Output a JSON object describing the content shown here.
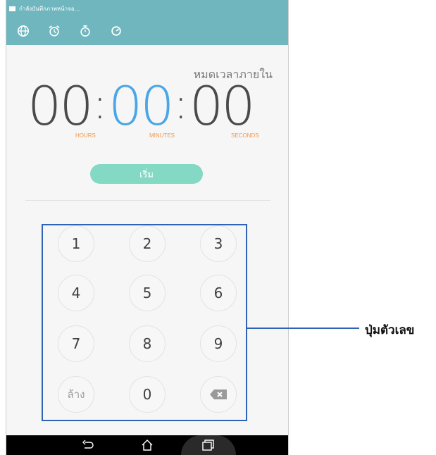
{
  "status_bar": {
    "text": "กำลังบันทึกภาพหน้าจอ..."
  },
  "tabs": [
    {
      "icon": "globe-icon",
      "name": "world clock"
    },
    {
      "icon": "alarm-icon",
      "name": "alarm"
    },
    {
      "icon": "stopwatch-icon",
      "name": "stopwatch"
    },
    {
      "icon": "timer-icon",
      "name": "timer"
    }
  ],
  "timer": {
    "prompt": "หมดเวลาภายใน",
    "hours": "00",
    "minutes": "00",
    "seconds": "00",
    "hours_label": "HOURS",
    "minutes_label": "MINUTES",
    "seconds_label": "SECONDS",
    "start_label": "เริ่ม"
  },
  "keypad": {
    "keys": [
      "1",
      "2",
      "3",
      "4",
      "5",
      "6",
      "7",
      "8",
      "9"
    ],
    "clear_label": "ล้าง",
    "zero": "0",
    "backspace_icon": "backspace-icon"
  },
  "nav_bar": {
    "back_icon": "back-icon",
    "home_icon": "home-icon",
    "recents_icon": "recents-icon"
  },
  "annotation": {
    "label": "ปุ่มตัวเลข"
  },
  "colors": {
    "header": "#6fb6be",
    "accent_blue": "#4aa6e6",
    "unit_orange": "#f0974a",
    "start_button": "#84d9c4",
    "callout": "#2f63b8"
  }
}
